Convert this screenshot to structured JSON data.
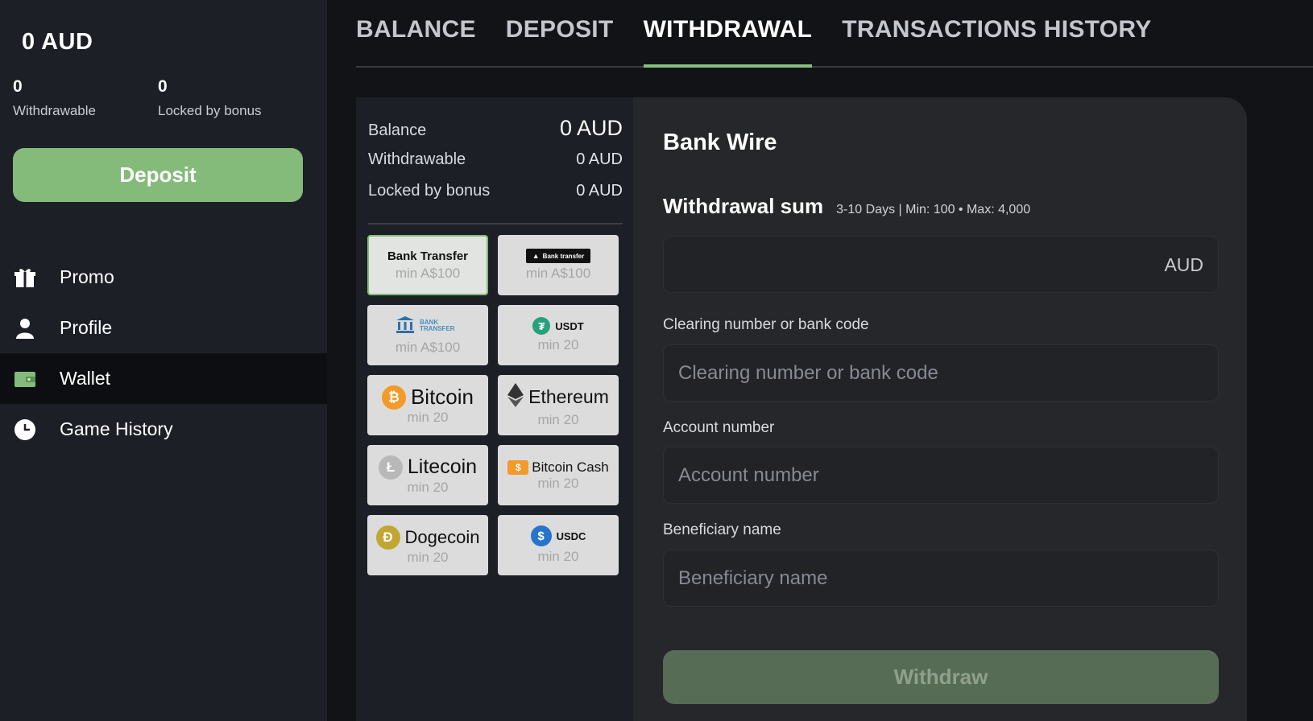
{
  "sidebar": {
    "balance_total": "0 AUD",
    "withdrawable_value": "0",
    "withdrawable_label": "Withdrawable",
    "locked_value": "0",
    "locked_label": "Locked by bonus",
    "deposit_label": "Deposit",
    "nav": [
      {
        "label": "Promo",
        "icon": "gift-icon"
      },
      {
        "label": "Profile",
        "icon": "user-icon"
      },
      {
        "label": "Wallet",
        "icon": "wallet-icon",
        "active": true
      },
      {
        "label": "Game History",
        "icon": "clock-icon"
      }
    ]
  },
  "tabs": [
    {
      "label": "BALANCE"
    },
    {
      "label": "DEPOSIT"
    },
    {
      "label": "WITHDRAWAL",
      "active": true
    },
    {
      "label": "TRANSACTIONS HISTORY"
    }
  ],
  "summary": {
    "balance_label": "Balance",
    "balance_value": "0 AUD",
    "withdrawable_label": "Withdrawable",
    "withdrawable_value": "0 AUD",
    "locked_label": "Locked by bonus",
    "locked_value": "0 AUD"
  },
  "methods": [
    {
      "name": "Bank Transfer",
      "min": "min A$100",
      "selected": true
    },
    {
      "name": "Bank transfer",
      "min": "min A$100"
    },
    {
      "name": "BANK TRANSFER",
      "min": "min A$100"
    },
    {
      "name": "USDT",
      "min": "min 20"
    },
    {
      "name": "Bitcoin",
      "min": "min 20"
    },
    {
      "name": "Ethereum",
      "min": "min 20"
    },
    {
      "name": "Litecoin",
      "min": "min 20"
    },
    {
      "name": "Bitcoin Cash",
      "min": "min 20"
    },
    {
      "name": "Dogecoin",
      "min": "min 20"
    },
    {
      "name": "USDC",
      "min": "min 20"
    }
  ],
  "form": {
    "title": "Bank Wire",
    "sum_label": "Withdrawal sum",
    "limits": "3-10 Days | Min: 100 • Max: 4,000",
    "currency": "AUD",
    "clearing_label": "Clearing number or bank code",
    "clearing_placeholder": "Clearing number or bank code",
    "account_label": "Account number",
    "account_placeholder": "Account number",
    "beneficiary_label": "Beneficiary name",
    "beneficiary_placeholder": "Beneficiary name",
    "withdraw_label": "Withdraw"
  },
  "colors": {
    "accent_green": "#84bb7b",
    "withdraw_disabled": "#566c54",
    "sidebar_bg": "#1c1f26"
  }
}
